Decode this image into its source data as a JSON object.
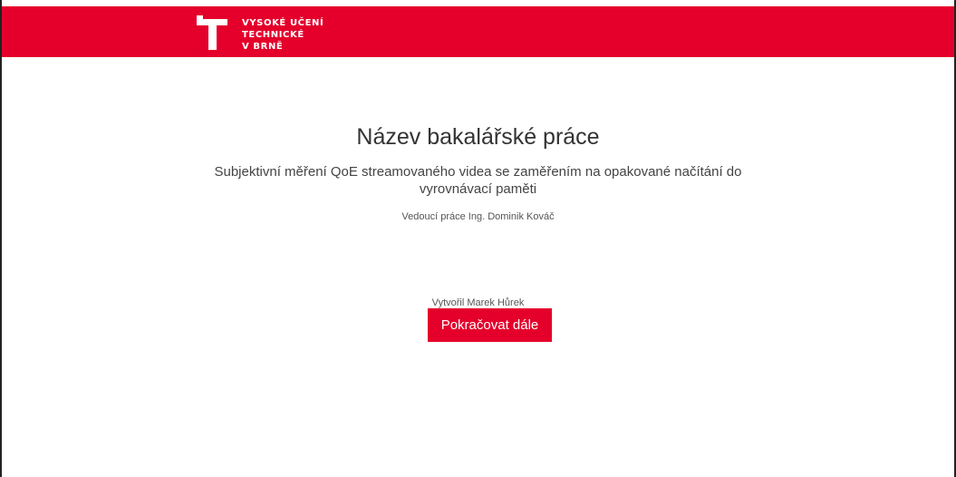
{
  "header": {
    "logo_lines": [
      "VYSOKÉ UČENÍ",
      "TECHNICKÉ",
      "V BRNĚ"
    ],
    "logo_icon": "vut-t-logo",
    "bg_color": "#e4002b"
  },
  "main": {
    "title": "Název bakalářské práce",
    "subtitle": "Subjektivní měření QoE streamovaného videa se zaměřením na opakované načítání do vyrovnávací paměti",
    "supervisor": "Vedoucí práce Ing. Dominik Kováč",
    "author": "Vytvořil Marek Hůrek",
    "continue_label": "Pokračovat dále",
    "accent_color": "#e4002b"
  }
}
